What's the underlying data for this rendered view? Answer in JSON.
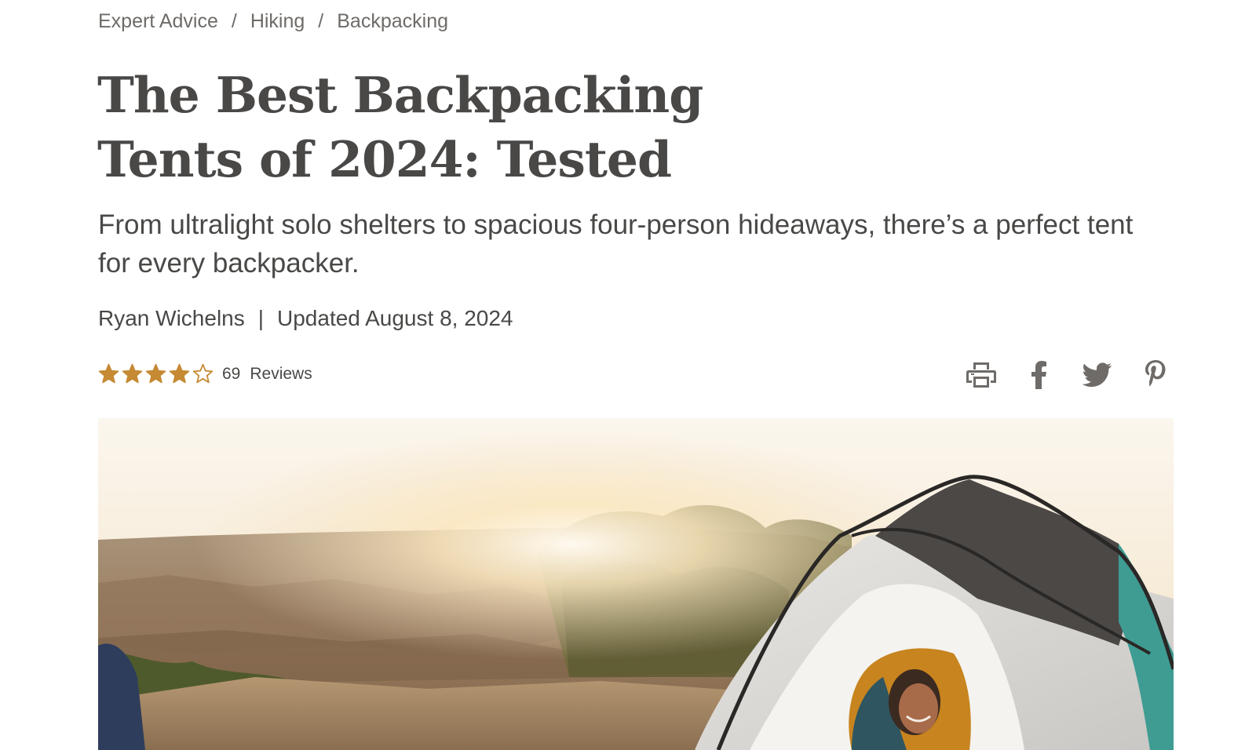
{
  "breadcrumb": {
    "items": [
      "Expert Advice",
      "Hiking",
      "Backpacking"
    ],
    "separator": "/"
  },
  "article": {
    "title_line1": "The Best Backpacking",
    "title_line2": "Tents of 2024: Tested",
    "subtitle": "From ultralight solo shelters to spacious four-person hideaways, there’s a perfect tent for every backpacker.",
    "author": "Ryan Wichelns",
    "byline_separator": "|",
    "updated": "Updated August 8, 2024"
  },
  "rating": {
    "stars": 4,
    "max_stars": 5,
    "count": "69",
    "label": "Reviews",
    "star_color": "#c58a33"
  },
  "share": {
    "icons": [
      "printer-icon",
      "facebook-icon",
      "twitter-icon",
      "pinterest-icon"
    ],
    "icon_color": "#6e6b68"
  },
  "hero": {
    "alt": "Backpacker in a sleeping bag inside a tent at sunrise above a canyon"
  },
  "colors": {
    "text": "#4a4846",
    "muted": "#6e6b68",
    "background": "#ffffff"
  }
}
